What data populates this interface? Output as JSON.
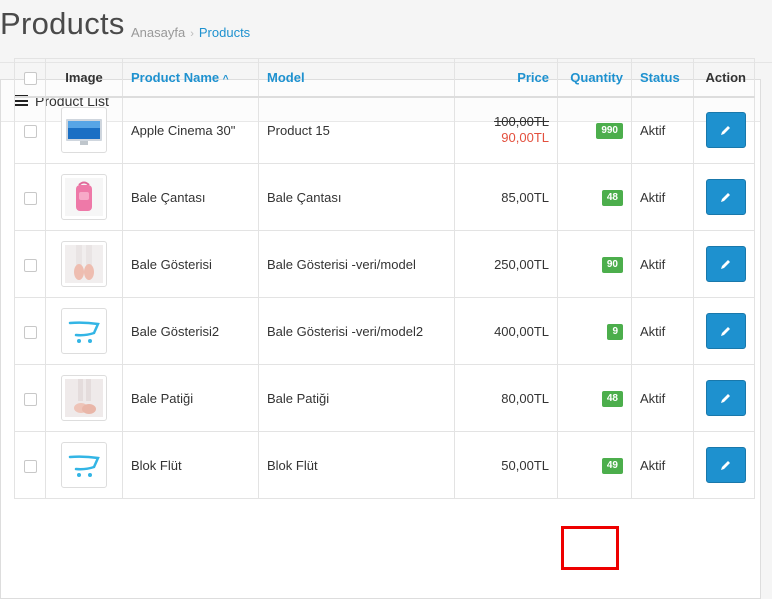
{
  "header": {
    "title": "Products",
    "breadcrumb": {
      "home": "Anasayfa",
      "separator": "›",
      "current": "Products"
    }
  },
  "panel": {
    "title": "Product List",
    "icon": "list-icon"
  },
  "table": {
    "columns": {
      "image": "Image",
      "name": "Product Name",
      "name_sort_indicator": "^",
      "model": "Model",
      "price": "Price",
      "quantity": "Quantity",
      "status": "Status",
      "action": "Action"
    },
    "rows": [
      {
        "image": "monitor-thumbnail",
        "name": "Apple Cinema 30\"",
        "model": "Product 15",
        "price": "100,00TL",
        "special_price": "90,00TL",
        "quantity": "990",
        "status": "Aktif"
      },
      {
        "image": "pink-bag-thumbnail",
        "name": "Bale Çantası",
        "model": "Bale Çantası",
        "price": "85,00TL",
        "quantity": "48",
        "status": "Aktif"
      },
      {
        "image": "ballet-shoes-thumbnail",
        "name": "Bale Gösterisi",
        "model": "Bale Gösterisi -veri/model",
        "price": "250,00TL",
        "quantity": "90",
        "status": "Aktif"
      },
      {
        "image": "cart-placeholder-thumbnail",
        "name": "Bale Gösterisi2",
        "model": "Bale Gösterisi -veri/model2",
        "price": "400,00TL",
        "quantity": "9",
        "status": "Aktif"
      },
      {
        "image": "ballet-slippers-thumbnail",
        "name": "Bale Patiği",
        "model": "Bale Patiği",
        "price": "80,00TL",
        "quantity": "48",
        "status": "Aktif"
      },
      {
        "image": "cart-placeholder-thumbnail",
        "name": "Blok Flüt",
        "model": "Blok Flüt",
        "price": "50,00TL",
        "quantity": "49",
        "status": "Aktif"
      }
    ]
  },
  "colors": {
    "link": "#1e91cf",
    "badge": "#4cae4c",
    "special_price": "#e3503e",
    "highlight": "#ee0000"
  }
}
